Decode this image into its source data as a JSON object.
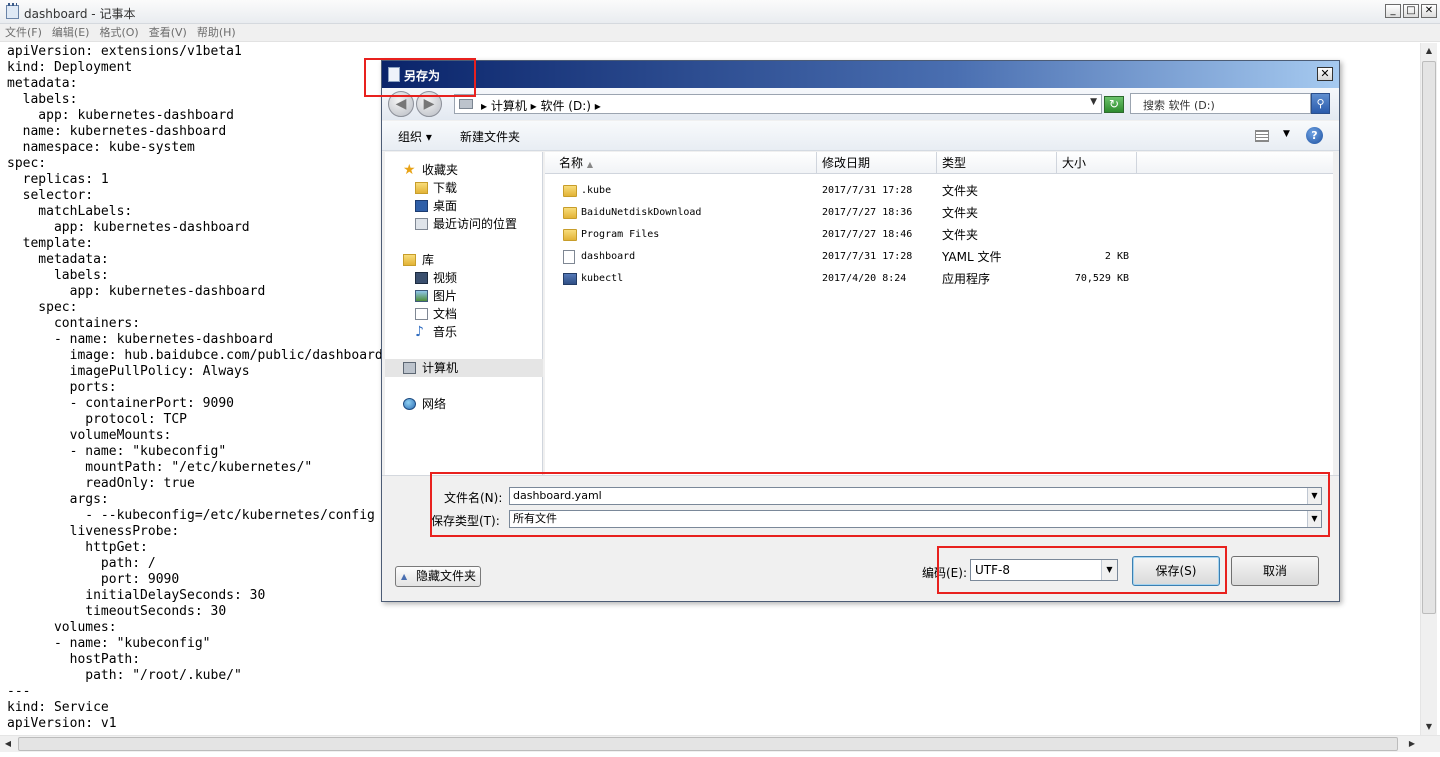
{
  "notepad": {
    "title_file": "dashboard",
    "title_sep": " - ",
    "title_app": "记事本",
    "menu": [
      "文件(F)",
      "编辑(E)",
      "格式(O)",
      "查看(V)",
      "帮助(H)"
    ],
    "content": "apiVersion: extensions/v1beta1\nkind: Deployment\nmetadata:\n  labels:\n    app: kubernetes-dashboard\n  name: kubernetes-dashboard\n  namespace: kube-system\nspec:\n  replicas: 1\n  selector:\n    matchLabels:\n      app: kubernetes-dashboard\n  template:\n    metadata:\n      labels:\n        app: kubernetes-dashboard\n    spec:\n      containers:\n      - name: kubernetes-dashboard\n        image: hub.baidubce.com/public/dashboard\n        imagePullPolicy: Always\n        ports:\n        - containerPort: 9090\n          protocol: TCP\n        volumeMounts:\n        - name: \"kubeconfig\"\n          mountPath: \"/etc/kubernetes/\"\n          readOnly: true\n        args:\n          - --kubeconfig=/etc/kubernetes/config\n        livenessProbe:\n          httpGet:\n            path: /\n            port: 9090\n          initialDelaySeconds: 30\n          timeoutSeconds: 30\n      volumes:\n      - name: \"kubeconfig\"\n        hostPath:\n          path: \"/root/.kube/\"\n---\nkind: Service\napiVersion: v1"
  },
  "dialog": {
    "title": "另存为",
    "close": "✕",
    "address": "▸ 计算机 ▸ 软件 (D:) ▸",
    "search_placeholder": "搜索 软件 (D:)",
    "toolbar": {
      "organize": "组织 ▾",
      "new_folder": "新建文件夹"
    },
    "nav": [
      {
        "label": "收藏夹",
        "icon": "star-icon"
      },
      {
        "label": "下载",
        "icon": "download-folder-icon"
      },
      {
        "label": "桌面",
        "icon": "desktop-icon"
      },
      {
        "label": "最近访问的位置",
        "icon": "recent-places-icon"
      },
      {
        "label": "库",
        "icon": "library-icon"
      },
      {
        "label": "视频",
        "icon": "video-icon"
      },
      {
        "label": "图片",
        "icon": "picture-icon"
      },
      {
        "label": "文档",
        "icon": "document-icon"
      },
      {
        "label": "音乐",
        "icon": "music-icon"
      },
      {
        "label": "计算机",
        "icon": "computer-icon"
      },
      {
        "label": "网络",
        "icon": "network-icon"
      }
    ],
    "columns": [
      "名称",
      "修改日期",
      "类型",
      "大小"
    ],
    "files": [
      {
        "name": ".kube",
        "date": "2017/7/31 17:28",
        "type": "文件夹",
        "size": "",
        "kind": "folder"
      },
      {
        "name": "BaiduNetdiskDownload",
        "date": "2017/7/27 18:36",
        "type": "文件夹",
        "size": "",
        "kind": "folder"
      },
      {
        "name": "Program Files",
        "date": "2017/7/27 18:46",
        "type": "文件夹",
        "size": "",
        "kind": "folder"
      },
      {
        "name": "dashboard",
        "date": "2017/7/31 17:28",
        "type": "YAML 文件",
        "size": "2 KB",
        "kind": "file"
      },
      {
        "name": "kubectl",
        "date": "2017/4/20 8:24",
        "type": "应用程序",
        "size": "70,529 KB",
        "kind": "exe"
      }
    ],
    "filename_label": "文件名(N):",
    "filename_value": "dashboard.yaml",
    "filetype_label": "保存类型(T):",
    "filetype_value": "所有文件",
    "hide_folders": "隐藏文件夹",
    "encoding_label": "编码(E):",
    "encoding_value": "UTF-8",
    "save": "保存(S)",
    "cancel": "取消"
  },
  "colors": {
    "highlight": "#e8211e",
    "title_bar": "#0a246a"
  }
}
